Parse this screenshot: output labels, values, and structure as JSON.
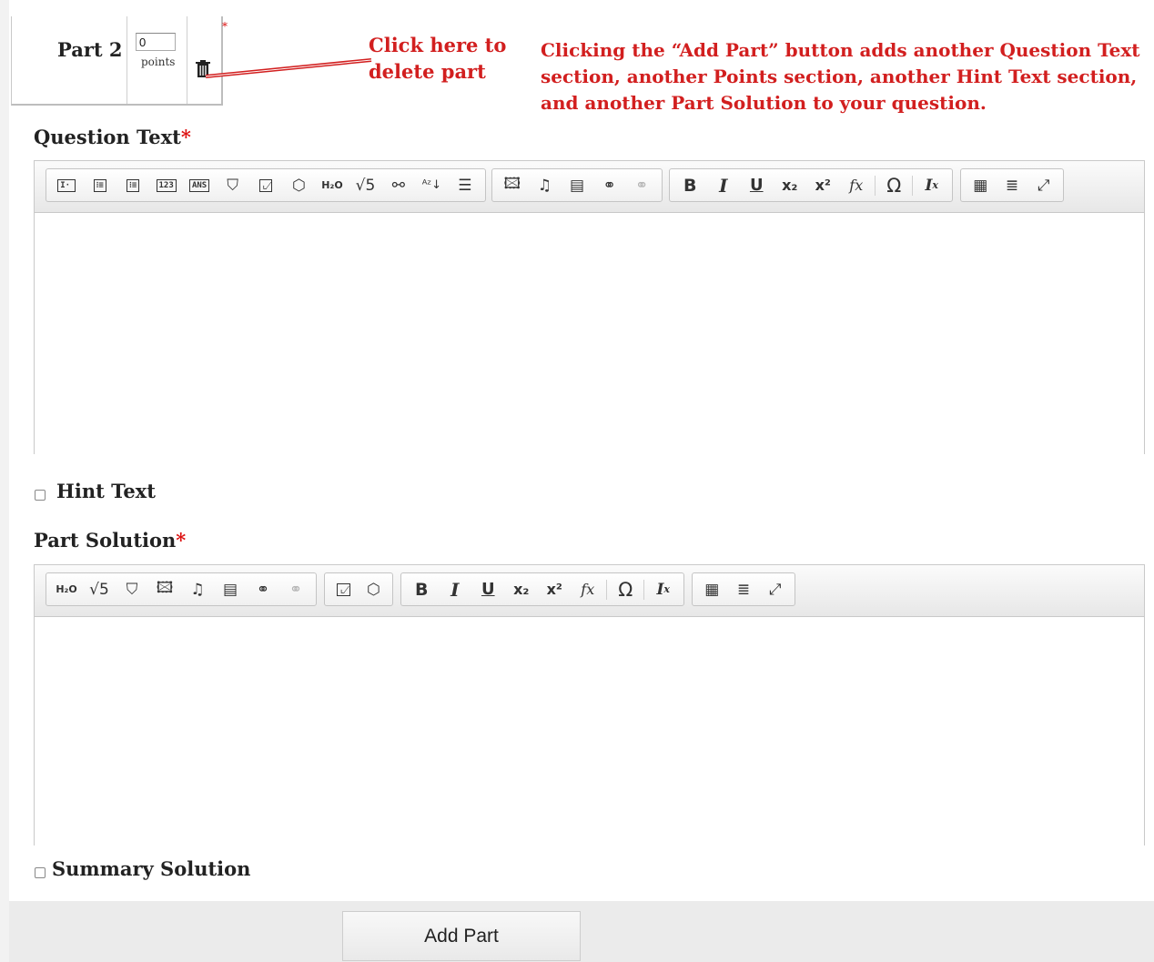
{
  "part": {
    "label": "Part 2",
    "points_value": "0",
    "points_label": "points",
    "required_marker": "*"
  },
  "annotations": {
    "delete_line1": "Click here to",
    "delete_line2": "delete part",
    "add_part_line1": "Clicking the “Add Part” button adds another Question Text",
    "add_part_line2": "section, another Points section, another Hint Text section,",
    "add_part_line3": "and another Part Solution to your question.",
    "color": "#d21f1f"
  },
  "question_text": {
    "label": "Question Text",
    "required": "*",
    "toolbar": {
      "group1": [
        {
          "name": "text-entry-icon",
          "glyph": "I"
        },
        {
          "name": "multiple-choice-icon",
          "glyph": "☷"
        },
        {
          "name": "multiple-select-icon",
          "glyph": "☷"
        },
        {
          "name": "numeric-entry-icon",
          "glyph": "123"
        },
        {
          "name": "answer-field-icon",
          "glyph": "ANS"
        },
        {
          "name": "drawing-icon",
          "glyph": "⟡"
        },
        {
          "name": "graph-icon",
          "glyph": "⌞"
        },
        {
          "name": "shape-icon",
          "glyph": "⬡"
        },
        {
          "name": "chemistry-icon",
          "glyph": "H₂O"
        },
        {
          "name": "square-root-icon",
          "glyph": "√5"
        },
        {
          "name": "molecule-icon",
          "glyph": "⚲"
        },
        {
          "name": "sort-icon",
          "glyph": "⇅"
        },
        {
          "name": "table-format-icon",
          "glyph": "☰"
        }
      ],
      "group2": [
        {
          "name": "image-icon",
          "glyph": "▣"
        },
        {
          "name": "audio-icon",
          "glyph": "♫"
        },
        {
          "name": "video-icon",
          "glyph": "🎬"
        },
        {
          "name": "link-icon",
          "glyph": "∞"
        },
        {
          "name": "unlink-icon",
          "glyph": "∞"
        }
      ],
      "group3": [
        {
          "name": "bold-icon",
          "glyph": "B"
        },
        {
          "name": "italic-icon",
          "glyph": "I"
        },
        {
          "name": "underline-icon",
          "glyph": "U"
        },
        {
          "name": "subscript-icon",
          "glyph": "x₂"
        },
        {
          "name": "superscript-icon",
          "glyph": "x²"
        },
        {
          "name": "formula-icon",
          "glyph": "fx"
        },
        {
          "name": "special-character-icon",
          "glyph": "Ω"
        },
        {
          "name": "remove-format-icon",
          "glyph": "Iₓ"
        }
      ],
      "group4": [
        {
          "name": "table-icon",
          "glyph": "▦"
        },
        {
          "name": "horizontal-line-icon",
          "glyph": "≣"
        },
        {
          "name": "maximize-icon",
          "glyph": "⤢"
        }
      ]
    }
  },
  "hint_text": {
    "label": "Hint Text"
  },
  "part_solution": {
    "label": "Part Solution",
    "required": "*"
  },
  "summary_solution": {
    "label": "Summary Solution"
  },
  "add_part_button": {
    "label": "Add Part"
  }
}
